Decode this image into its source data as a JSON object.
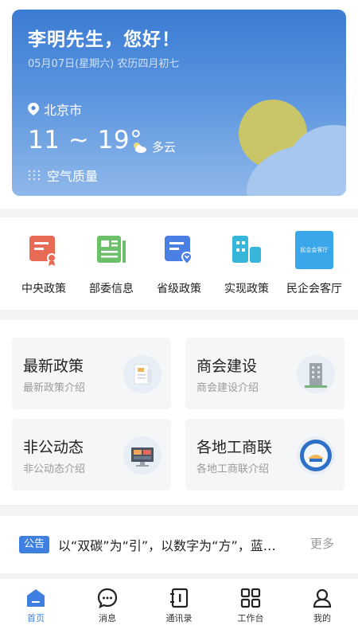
{
  "weather": {
    "greeting": "李明先生，您好！",
    "date": "05月07日(星期六)  农历四月初七",
    "city": "北京市",
    "temperature": "11 ~ 19°",
    "condition": "多云",
    "air_quality_label": "空气质量"
  },
  "quick_links": [
    {
      "label": "中央政策",
      "icon": "central-policy-icon"
    },
    {
      "label": "部委信息",
      "icon": "ministry-info-icon"
    },
    {
      "label": "省级政策",
      "icon": "provincial-policy-icon"
    },
    {
      "label": "实现政策",
      "icon": "implementation-policy-icon"
    },
    {
      "label": "民企会客厅",
      "icon": "reception-hall-icon",
      "icon_text": "民企会客厅"
    }
  ],
  "cards": [
    {
      "title": "最新政策",
      "subtitle": "最新政策介绍"
    },
    {
      "title": "商会建设",
      "subtitle": "商会建设介绍"
    },
    {
      "title": "非公动态",
      "subtitle": "非公动态介绍"
    },
    {
      "title": "各地工商联",
      "subtitle": "各地工商联介绍"
    }
  ],
  "notice": {
    "badge": "公告",
    "text": "以“双碳”为“引”，以数字为“方”，蓝…",
    "more": "更多"
  },
  "tabs": [
    {
      "label": "首页",
      "icon": "home-icon",
      "active": true
    },
    {
      "label": "消息",
      "icon": "message-icon",
      "active": false
    },
    {
      "label": "通讯录",
      "icon": "contacts-icon",
      "active": false
    },
    {
      "label": "工作台",
      "icon": "workbench-icon",
      "active": false
    },
    {
      "label": "我的",
      "icon": "profile-icon",
      "active": false
    }
  ],
  "colors": {
    "accent": "#3e7fe0",
    "card_blue": "#3a7bd3"
  }
}
